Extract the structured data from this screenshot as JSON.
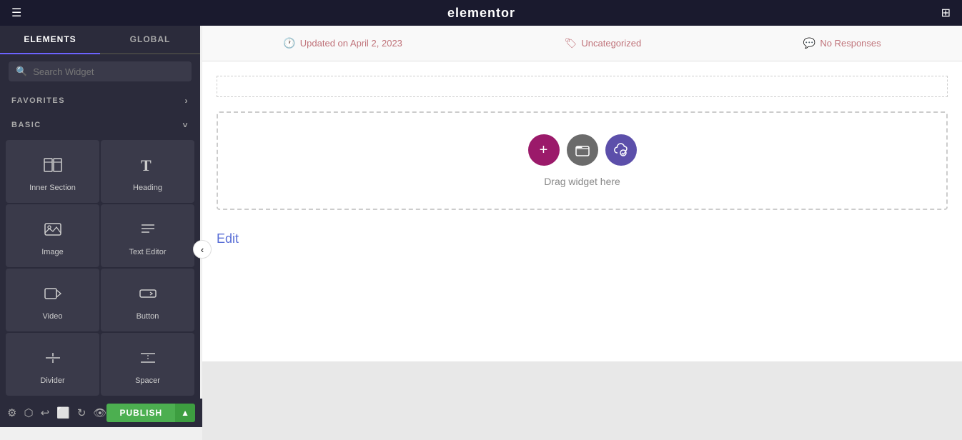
{
  "topbar": {
    "logo": "elementor",
    "hamburger_icon": "☰",
    "grid_icon": "⊞"
  },
  "sidebar": {
    "tabs": [
      {
        "label": "ELEMENTS",
        "active": true
      },
      {
        "label": "GLOBAL",
        "active": false
      }
    ],
    "search": {
      "placeholder": "Search Widget",
      "value": ""
    },
    "sections": [
      {
        "label": "FAVORITES",
        "collapsed": true
      },
      {
        "label": "BASIC",
        "collapsed": false
      }
    ],
    "widgets": [
      {
        "label": "Inner Section",
        "icon": "inner-section"
      },
      {
        "label": "Heading",
        "icon": "heading"
      },
      {
        "label": "Image",
        "icon": "image"
      },
      {
        "label": "Text Editor",
        "icon": "text-editor"
      },
      {
        "label": "Video",
        "icon": "video"
      },
      {
        "label": "Button",
        "icon": "button"
      },
      {
        "label": "Divider",
        "icon": "divider"
      },
      {
        "label": "Spacer",
        "icon": "spacer"
      }
    ]
  },
  "bottom_toolbar": {
    "tools": [
      "settings",
      "layers",
      "history",
      "responsive",
      "redo",
      "eye"
    ],
    "publish_label": "PUBLISH"
  },
  "canvas": {
    "post_meta": [
      {
        "icon": "🕐",
        "text": "Updated on April 2, 2023"
      },
      {
        "icon": "🏷",
        "text": "Uncategorized"
      },
      {
        "icon": "💬",
        "text": "No Responses"
      }
    ],
    "drop_zone_text": "Drag widget here",
    "edit_text": "Edit"
  },
  "colors": {
    "topbar_bg": "#1a1a2e",
    "sidebar_bg": "#2b2b3b",
    "widget_bg": "#3a3a4a",
    "active_tab": "#6c63ff",
    "add_btn": "#9b1a6a",
    "folder_btn": "#6b6b6b",
    "cloud_btn": "#5c4faa",
    "publish_btn": "#4CAF50",
    "meta_color": "#c0737a",
    "edit_color": "#5a6fd6"
  }
}
